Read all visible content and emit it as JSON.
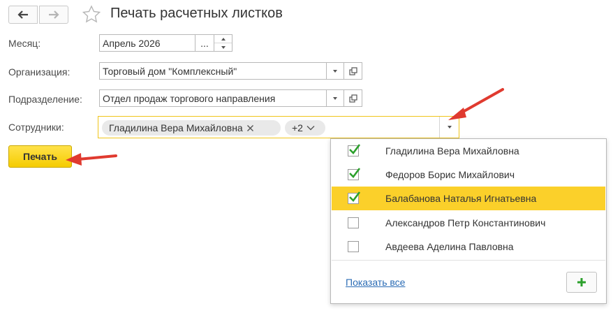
{
  "header": {
    "title": "Печать расчетных листков"
  },
  "form": {
    "month_label": "Месяц:",
    "month_value": "Апрель 2026",
    "month_choose": "...",
    "org_label": "Организация:",
    "org_value": "Торговый дом \"Комплексный\"",
    "dept_label": "Подразделение:",
    "dept_value": "Отдел продаж торгового направления",
    "emp_label": "Сотрудники:",
    "emp_chip": "Гладилина Вера Михайловна",
    "emp_more": "+2"
  },
  "print_button": "Печать",
  "dropdown": {
    "items": [
      {
        "name": "Гладилина Вера Михайловна",
        "checked": true
      },
      {
        "name": "Федоров Борис Михайлович",
        "checked": true
      },
      {
        "name": "Балабанова Наталья Игнатьевна",
        "checked": true,
        "highlighted": true
      },
      {
        "name": "Александров Петр Константинович",
        "checked": false
      },
      {
        "name": "Авдеева Аделина Павловна",
        "checked": false
      }
    ],
    "show_all": "Показать все"
  },
  "colors": {
    "accent": "#fbd02a",
    "check": "#2ca02c",
    "link": "#2b6cb5",
    "annotation": "#e03a2f"
  }
}
